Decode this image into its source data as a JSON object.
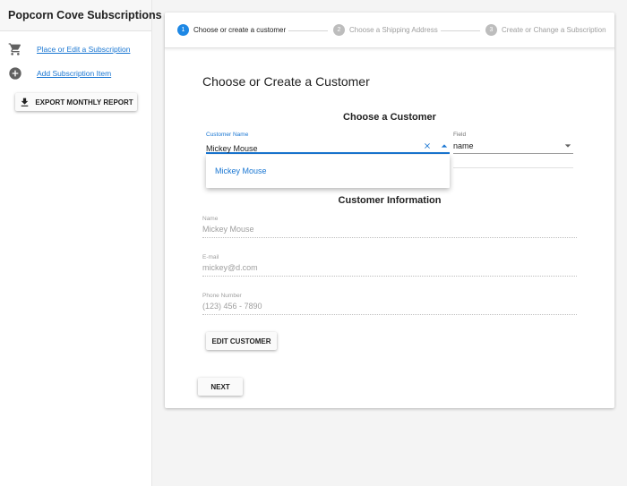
{
  "sidebar": {
    "title": "Popcorn Cove Subscriptions",
    "items": [
      {
        "label": "Place or Edit a Subscription",
        "icon": "cart-icon"
      },
      {
        "label": "Add Subscription Item",
        "icon": "plus-circle-icon"
      }
    ],
    "export_label": "EXPORT MONTHLY REPORT"
  },
  "stepper": {
    "steps": [
      {
        "number": "1",
        "label": "Choose or create a customer",
        "active": true
      },
      {
        "number": "2",
        "label": "Choose a Shipping Address",
        "active": false
      },
      {
        "number": "3",
        "label": "Create or Change a Subscription",
        "active": false
      }
    ]
  },
  "form": {
    "title": "Choose or Create a Customer",
    "choose_heading": "Choose a Customer",
    "customer_name_label": "Customer Name",
    "customer_name_value": "Mickey Mouse",
    "field_label": "Field",
    "field_value": "name",
    "dropdown_options": [
      "Mickey Mouse"
    ],
    "info_heading": "Customer Information",
    "info_fields": [
      {
        "label": "Name",
        "value": "Mickey Mouse"
      },
      {
        "label": "E-mail",
        "value": "mickey@d.com"
      },
      {
        "label": "Phone Number",
        "value": "(123) 456 - 7890"
      }
    ],
    "edit_label": "EDIT CUSTOMER",
    "next_label": "NEXT"
  },
  "colors": {
    "accent": "#1976d2",
    "step_active": "#1e88e5",
    "step_inactive": "#bdbdbd"
  }
}
